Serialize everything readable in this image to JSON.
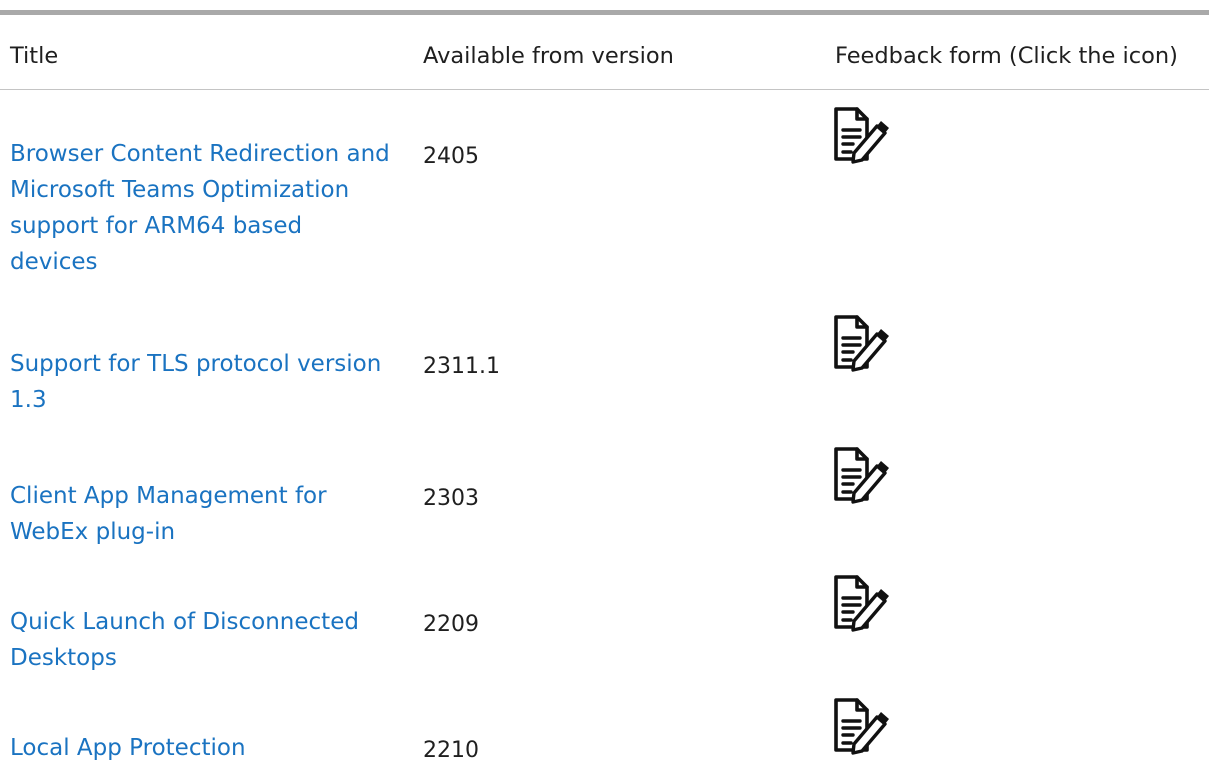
{
  "table": {
    "headers": {
      "title": "Title",
      "version": "Available from version",
      "feedback": "Feedback form (Click the icon)"
    },
    "rows": [
      {
        "title": "Browser Content Redirection and Microsoft Teams Optimization support for ARM64 based devices",
        "version": "2405",
        "feedback_icon": "feedback-form-icon"
      },
      {
        "title": "Support for TLS protocol version 1.3",
        "version": "2311.1",
        "feedback_icon": "feedback-form-icon"
      },
      {
        "title": "Client App Management for WebEx plug-in",
        "version": "2303",
        "feedback_icon": "feedback-form-icon"
      },
      {
        "title": "Quick Launch of Disconnected Desktops",
        "version": "2209",
        "feedback_icon": "feedback-form-icon"
      },
      {
        "title": "Local App Protection",
        "version": "2210",
        "feedback_icon": "feedback-form-icon"
      }
    ]
  },
  "colors": {
    "link": "#1a73c1",
    "text": "#1f1f1f",
    "rule": "#a9a9a9"
  }
}
